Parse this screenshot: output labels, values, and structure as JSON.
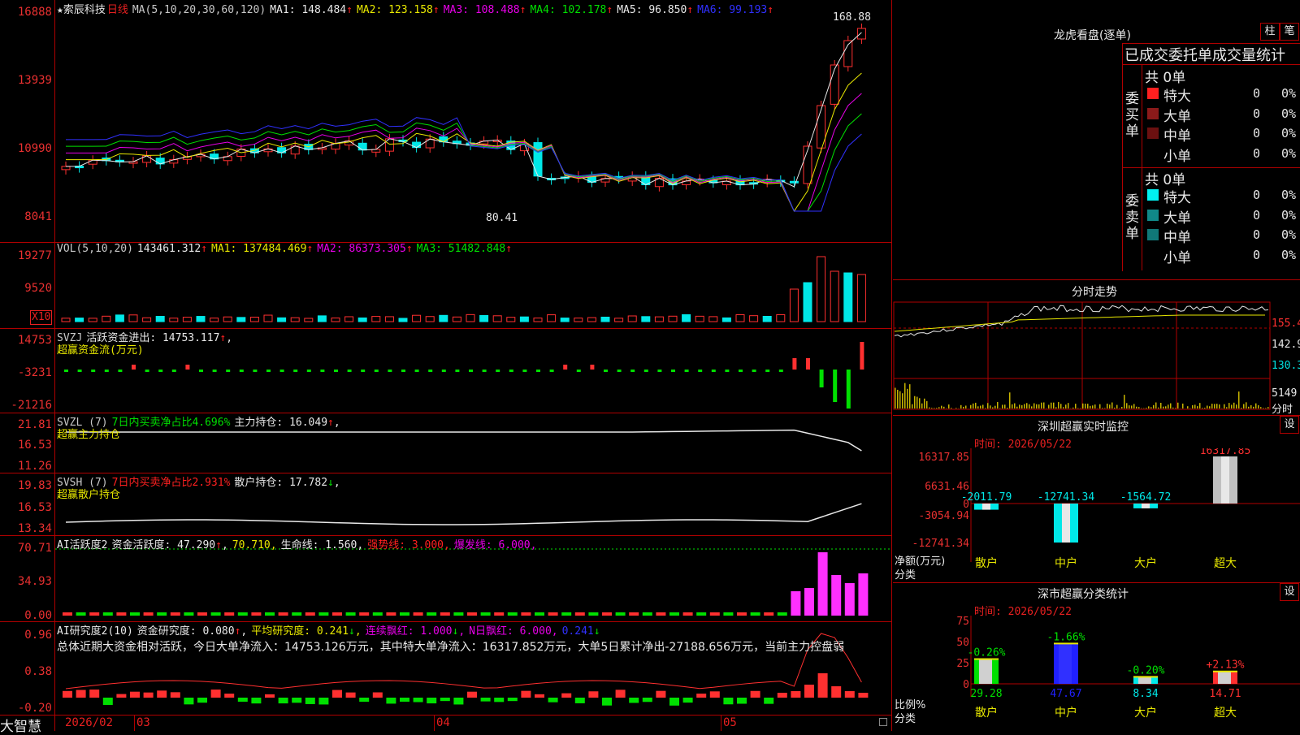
{
  "stock": {
    "name": "★索辰科技",
    "period": "日线",
    "ma_label": "MA(5,10,20,30,60,120)"
  },
  "ma": [
    {
      "label": "MA1: 148.484",
      "color": "#e8e8e8"
    },
    {
      "label": "MA2: 123.158",
      "color": "#e8e800"
    },
    {
      "label": "MA3: 108.488",
      "color": "#e800e8"
    },
    {
      "label": "MA4: 102.178",
      "color": "#00e000"
    },
    {
      "label": "MA5: 96.850",
      "color": "#e8e8e8"
    },
    {
      "label": "MA6: 99.193",
      "color": "#3030ff"
    }
  ],
  "up_arrow": "↑",
  "down_arrow": "↓",
  "price_axis": [
    "16888",
    "13939",
    "10990",
    "8041"
  ],
  "price_high": "168.88",
  "price_low": "80.41",
  "vol": {
    "title": "VOL(5,10,20)",
    "value": "143461.312",
    "ma": [
      "MA1: 137484.469",
      "MA2: 86373.305",
      "MA3: 51482.848"
    ],
    "axis": [
      "19277",
      "9520"
    ],
    "unit": "X10"
  },
  "svzj": {
    "title": "SVZJ",
    "label": "活跃资金进出: 14753.117",
    "sub": "超赢资金流(万元)",
    "axis": [
      "14753",
      "-3231",
      "-21216"
    ]
  },
  "svzl": {
    "title": "SVZL (7)",
    "label1": "7日内买卖净占比4.696%",
    "label2": "主力持仓: 16.049",
    "sub": "超赢主力持仓",
    "axis": [
      "21.81",
      "16.53",
      "11.26"
    ]
  },
  "svsh": {
    "title": "SVSH (7)",
    "label1": "7日内买卖净占比2.931%",
    "label2": "散户持仓: 17.782",
    "sub": "超赢散户持仓",
    "axis": [
      "19.83",
      "16.53",
      "13.34"
    ]
  },
  "ai1": {
    "title": "AI活跃度2",
    "items": [
      "资金活跃度: 47.290",
      "70.710",
      "生命线: 1.560",
      "强势线: 3.000",
      "爆发线: 6.000"
    ],
    "axis": [
      "70.71",
      "34.93",
      "0.00"
    ]
  },
  "ai2": {
    "title": "AI研究度2(10)",
    "items": [
      "资金研究度: 0.080",
      "平均研究度: 0.241",
      "连续飘红: 1.000",
      "N日飘红: 6.000",
      "0.241"
    ],
    "summary": "总体近期大资金相对活跃，今日大单净流入：14753.126万元，其中特大单净流入：16317.852万元，大单5日累计净出-27188.656万元，当前主力控盘弱",
    "axis": [
      "0.96",
      "0.38",
      "-0.20"
    ]
  },
  "date_axis": {
    "brand": "大智慧",
    "labels": [
      "2026/02",
      "03",
      "04",
      "05"
    ]
  },
  "right": {
    "lhb_title": "龙虎看盘(逐单)",
    "btn_bar": "柱",
    "btn_pen": "笔",
    "stats_title": "已成交委托单成交量统计",
    "buy_label": "委买单",
    "sell_label": "委卖单",
    "total": "共 0单",
    "rows": [
      "特大",
      "大单",
      "中单",
      "小单"
    ],
    "zero": "0",
    "pct": "0%",
    "fs_title": "分时走势",
    "fs_axis": [
      "155.4",
      "142.9",
      "130.3",
      "5149",
      "分时"
    ],
    "sz_title": "深圳超赢实时监控",
    "set": "设",
    "time": "时间: 2026/05/22",
    "sz_axis": [
      "16317.85",
      "6631.46",
      "0",
      "-3054.94",
      "-12741.34"
    ],
    "sz_ylabel": "净额(万元)",
    "cat": "分类",
    "sz_cats": [
      "散户",
      "中户",
      "大户",
      "超大"
    ],
    "sz_values": [
      -2011.79,
      -12741.34,
      -1564.72,
      16317.85
    ],
    "sz_value_labels": [
      "-2011.79",
      "-12741.34",
      "-1564.72",
      "16317.85"
    ],
    "cls_title": "深市超赢分类统计",
    "cls_axis": [
      "75",
      "50",
      "25",
      "0"
    ],
    "cls_values": [
      29.28,
      47.67,
      8.34,
      14.71
    ],
    "cls_changes": [
      "-0.26%",
      "-1.66%",
      "-0.20%",
      "+2.13%"
    ],
    "cls_ylabel": "比例%",
    "cls_cats": [
      "散户",
      "中户",
      "大户",
      "超大"
    ]
  }
}
